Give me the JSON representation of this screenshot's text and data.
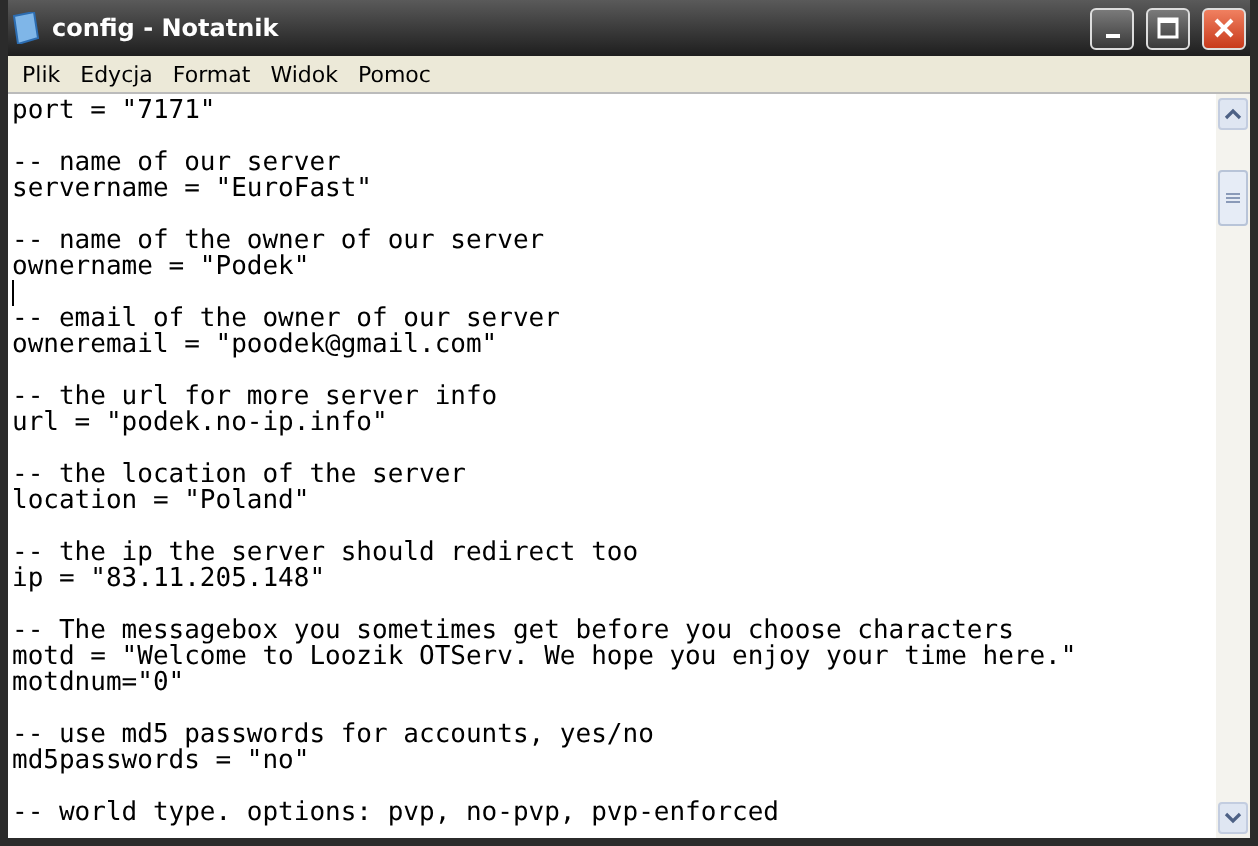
{
  "window": {
    "title": "config - Notatnik"
  },
  "menu": [
    "Plik",
    "Edycja",
    "Format",
    "Widok",
    "Pomoc"
  ],
  "editor": {
    "blocks": [
      {
        "lines": [
          "port = \"7171\""
        ],
        "caret_before": false
      },
      {
        "lines": [
          "-- name of our server",
          "servername = \"EuroFast\""
        ],
        "caret_before": false
      },
      {
        "lines": [
          "-- name of the owner of our server",
          "ownername = \"Podek\""
        ],
        "caret_before": false
      },
      {
        "lines": [
          "-- email of the owner of our server",
          "owneremail = \"poodek@gmail.com\""
        ],
        "caret_before": true
      },
      {
        "lines": [
          "-- the url for more server info",
          "url = \"podek.no-ip.info\""
        ],
        "caret_before": false
      },
      {
        "lines": [
          "-- the location of the server",
          "location = \"Poland\""
        ],
        "caret_before": false
      },
      {
        "lines": [
          "-- the ip the server should redirect too",
          "ip = \"83.11.205.148\""
        ],
        "caret_before": false
      },
      {
        "lines": [
          "-- The messagebox you sometimes get before you choose characters",
          "motd = \"Welcome to Loozik OTServ. We hope you enjoy your time here.\"",
          "motdnum=\"0\""
        ],
        "caret_before": false
      },
      {
        "lines": [
          "-- use md5 passwords for accounts, yes/no",
          "md5passwords = \"no\""
        ],
        "caret_before": false
      },
      {
        "lines": [
          "-- world type. options: pvp, no-pvp, pvp-enforced"
        ],
        "caret_before": false
      }
    ]
  }
}
